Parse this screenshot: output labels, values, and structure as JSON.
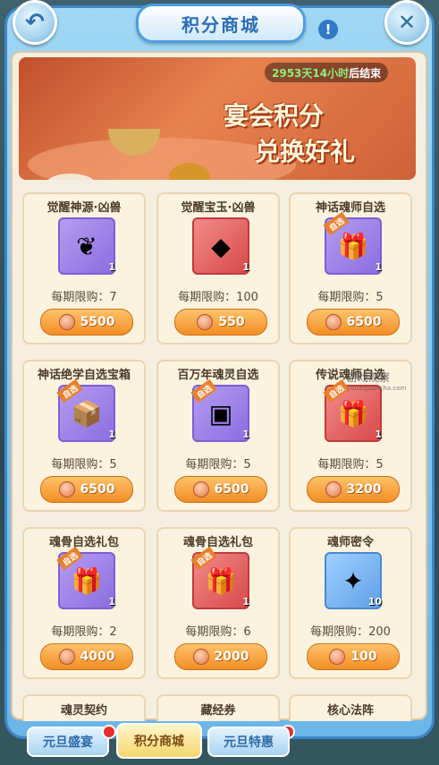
{
  "header": {
    "title": "积分商城",
    "back_icon": "back-arrow-icon",
    "close_icon": "close-icon",
    "info": "!"
  },
  "banner": {
    "countdown_value": "2953天14小时",
    "countdown_suffix": "后结束",
    "line1": "宴会积分",
    "line2": "兑换好礼"
  },
  "items": [
    {
      "name": "觉醒神源·凶兽",
      "qty": "1",
      "limit": "每期限购：7",
      "price": "5500",
      "tag": ""
    },
    {
      "name": "觉醒宝玉·凶兽",
      "qty": "1",
      "limit": "每期限购：100",
      "price": "550",
      "tag": ""
    },
    {
      "name": "神话魂师自选",
      "qty": "1",
      "limit": "每期限购：5",
      "price": "6500",
      "tag": "自选"
    },
    {
      "name": "神话绝学自选宝箱",
      "qty": "1",
      "limit": "每期限购：5",
      "price": "6500",
      "tag": "自选"
    },
    {
      "name": "百万年魂灵自选",
      "qty": "1",
      "limit": "每期限购：5",
      "price": "6500",
      "tag": "自选"
    },
    {
      "name": "传说魂师自选",
      "qty": "1",
      "limit": "每期限购：5",
      "price": "3200",
      "tag": "自选"
    },
    {
      "name": "魂骨自选礼包",
      "qty": "1",
      "limit": "每期限购：2",
      "price": "4000",
      "tag": "自选"
    },
    {
      "name": "魂骨自选礼包",
      "qty": "1",
      "limit": "每期限购：6",
      "price": "2000",
      "tag": "自选"
    },
    {
      "name": "魂师密令",
      "qty": "10",
      "limit": "每期限购：200",
      "price": "100",
      "tag": ""
    }
  ],
  "partial_items": [
    "魂灵契约",
    "藏经券",
    "核心法阵"
  ],
  "tabs": [
    {
      "label": "元旦盛宴",
      "active": false,
      "badge": true
    },
    {
      "label": "积分商城",
      "active": true,
      "badge": true
    },
    {
      "label": "元旦特惠",
      "active": false,
      "badge": false
    }
  ],
  "watermark": {
    "text": "游戏观察",
    "sub": "youxiguancha.com"
  }
}
